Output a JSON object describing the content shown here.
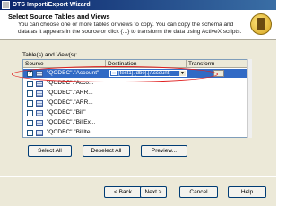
{
  "window": {
    "title": "DTS Import/Export Wizard"
  },
  "header": {
    "title": "Select Source Tables and Views",
    "description": "You can choose one or more tables or views to copy. You can copy the schema and data as it appears in the source or click {...} to transform the data using ActiveX scripts."
  },
  "tables_label": "Table(s) and View(s):",
  "columns": {
    "source": "Source",
    "destination": "Destination",
    "transform": "Transform"
  },
  "rows": [
    {
      "source": "\"QODBC\".\"Account\"",
      "checked": true,
      "destination": "[test1].[dbo].[Account]",
      "transform": "..."
    },
    {
      "source": "\"QODBC\".\"Acco...",
      "checked": false
    },
    {
      "source": "\"QODBC\".\"ARR...",
      "checked": false
    },
    {
      "source": "\"QODBC\".\"ARR...",
      "checked": false
    },
    {
      "source": "\"QODBC\".\"Bill\"",
      "checked": false
    },
    {
      "source": "\"QODBC\".\"BillEx...",
      "checked": false
    },
    {
      "source": "\"QODBC\".\"BillIte...",
      "checked": false
    }
  ],
  "buttons": {
    "select_all": "Select All",
    "deselect_all": "Deselect All",
    "preview": "Preview...",
    "back": "< Back",
    "next": "Next >",
    "cancel": "Cancel",
    "help": "Help"
  },
  "colors": {
    "selection": "#316ac5",
    "highlight_ring": "#e02020"
  }
}
